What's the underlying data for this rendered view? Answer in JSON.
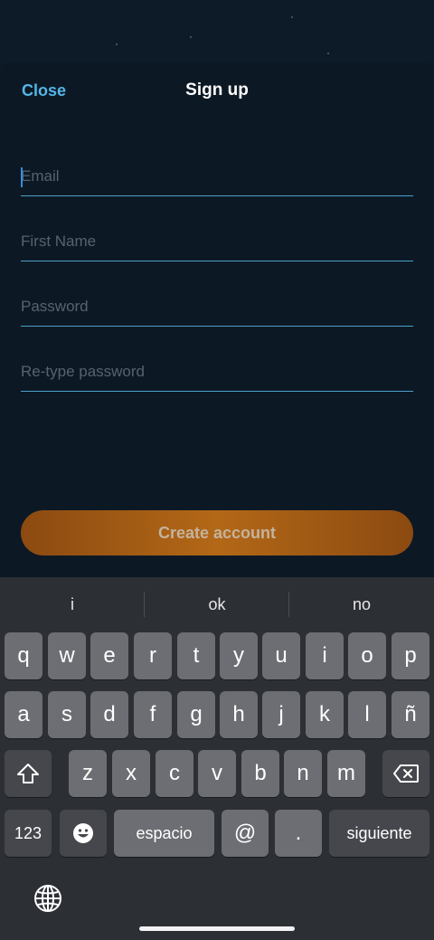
{
  "header": {
    "close_label": "Close",
    "title": "Sign up"
  },
  "form": {
    "email_placeholder": "Email",
    "first_name_placeholder": "First Name",
    "password_placeholder": "Password",
    "retype_password_placeholder": "Re-type password",
    "submit_label": "Create account"
  },
  "keyboard": {
    "suggestions": [
      "i",
      "ok",
      "no"
    ],
    "row1": [
      "q",
      "w",
      "e",
      "r",
      "t",
      "y",
      "u",
      "i",
      "o",
      "p"
    ],
    "row2": [
      "a",
      "s",
      "d",
      "f",
      "g",
      "h",
      "j",
      "k",
      "l",
      "ñ"
    ],
    "row3": [
      "z",
      "x",
      "c",
      "v",
      "b",
      "n",
      "m"
    ],
    "numbers_label": "123",
    "space_label": "espacio",
    "at_label": "@",
    "dot_label": ".",
    "next_label": "siguiente",
    "icons": [
      "shift-icon",
      "delete-icon",
      "emoji-icon",
      "globe-icon"
    ]
  },
  "colors": {
    "accent": "#56b5e8",
    "cta": "#b36817",
    "background": "#0c1925",
    "keyboard": "#2c2f34"
  }
}
